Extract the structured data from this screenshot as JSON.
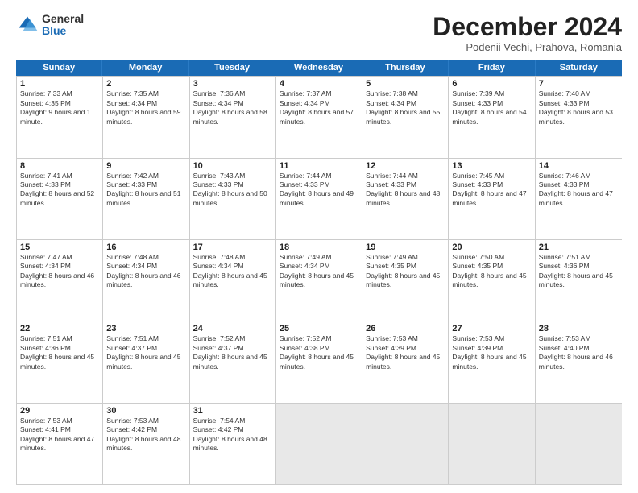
{
  "logo": {
    "general": "General",
    "blue": "Blue"
  },
  "header": {
    "month": "December 2024",
    "location": "Podenii Vechi, Prahova, Romania"
  },
  "days": [
    "Sunday",
    "Monday",
    "Tuesday",
    "Wednesday",
    "Thursday",
    "Friday",
    "Saturday"
  ],
  "weeks": [
    [
      {
        "day": "1",
        "rise": "7:33 AM",
        "set": "4:35 PM",
        "daylight": "9 hours and 1 minute."
      },
      {
        "day": "2",
        "rise": "7:35 AM",
        "set": "4:34 PM",
        "daylight": "8 hours and 59 minutes."
      },
      {
        "day": "3",
        "rise": "7:36 AM",
        "set": "4:34 PM",
        "daylight": "8 hours and 58 minutes."
      },
      {
        "day": "4",
        "rise": "7:37 AM",
        "set": "4:34 PM",
        "daylight": "8 hours and 57 minutes."
      },
      {
        "day": "5",
        "rise": "7:38 AM",
        "set": "4:34 PM",
        "daylight": "8 hours and 55 minutes."
      },
      {
        "day": "6",
        "rise": "7:39 AM",
        "set": "4:33 PM",
        "daylight": "8 hours and 54 minutes."
      },
      {
        "day": "7",
        "rise": "7:40 AM",
        "set": "4:33 PM",
        "daylight": "8 hours and 53 minutes."
      }
    ],
    [
      {
        "day": "8",
        "rise": "7:41 AM",
        "set": "4:33 PM",
        "daylight": "8 hours and 52 minutes."
      },
      {
        "day": "9",
        "rise": "7:42 AM",
        "set": "4:33 PM",
        "daylight": "8 hours and 51 minutes."
      },
      {
        "day": "10",
        "rise": "7:43 AM",
        "set": "4:33 PM",
        "daylight": "8 hours and 50 minutes."
      },
      {
        "day": "11",
        "rise": "7:44 AM",
        "set": "4:33 PM",
        "daylight": "8 hours and 49 minutes."
      },
      {
        "day": "12",
        "rise": "7:44 AM",
        "set": "4:33 PM",
        "daylight": "8 hours and 48 minutes."
      },
      {
        "day": "13",
        "rise": "7:45 AM",
        "set": "4:33 PM",
        "daylight": "8 hours and 47 minutes."
      },
      {
        "day": "14",
        "rise": "7:46 AM",
        "set": "4:33 PM",
        "daylight": "8 hours and 47 minutes."
      }
    ],
    [
      {
        "day": "15",
        "rise": "7:47 AM",
        "set": "4:34 PM",
        "daylight": "8 hours and 46 minutes."
      },
      {
        "day": "16",
        "rise": "7:48 AM",
        "set": "4:34 PM",
        "daylight": "8 hours and 46 minutes."
      },
      {
        "day": "17",
        "rise": "7:48 AM",
        "set": "4:34 PM",
        "daylight": "8 hours and 45 minutes."
      },
      {
        "day": "18",
        "rise": "7:49 AM",
        "set": "4:34 PM",
        "daylight": "8 hours and 45 minutes."
      },
      {
        "day": "19",
        "rise": "7:49 AM",
        "set": "4:35 PM",
        "daylight": "8 hours and 45 minutes."
      },
      {
        "day": "20",
        "rise": "7:50 AM",
        "set": "4:35 PM",
        "daylight": "8 hours and 45 minutes."
      },
      {
        "day": "21",
        "rise": "7:51 AM",
        "set": "4:36 PM",
        "daylight": "8 hours and 45 minutes."
      }
    ],
    [
      {
        "day": "22",
        "rise": "7:51 AM",
        "set": "4:36 PM",
        "daylight": "8 hours and 45 minutes."
      },
      {
        "day": "23",
        "rise": "7:51 AM",
        "set": "4:37 PM",
        "daylight": "8 hours and 45 minutes."
      },
      {
        "day": "24",
        "rise": "7:52 AM",
        "set": "4:37 PM",
        "daylight": "8 hours and 45 minutes."
      },
      {
        "day": "25",
        "rise": "7:52 AM",
        "set": "4:38 PM",
        "daylight": "8 hours and 45 minutes."
      },
      {
        "day": "26",
        "rise": "7:53 AM",
        "set": "4:39 PM",
        "daylight": "8 hours and 45 minutes."
      },
      {
        "day": "27",
        "rise": "7:53 AM",
        "set": "4:39 PM",
        "daylight": "8 hours and 45 minutes."
      },
      {
        "day": "28",
        "rise": "7:53 AM",
        "set": "4:40 PM",
        "daylight": "8 hours and 46 minutes."
      }
    ],
    [
      {
        "day": "29",
        "rise": "7:53 AM",
        "set": "4:41 PM",
        "daylight": "8 hours and 47 minutes."
      },
      {
        "day": "30",
        "rise": "7:53 AM",
        "set": "4:42 PM",
        "daylight": "8 hours and 48 minutes."
      },
      {
        "day": "31",
        "rise": "7:54 AM",
        "set": "4:42 PM",
        "daylight": "8 hours and 48 minutes."
      },
      null,
      null,
      null,
      null
    ]
  ],
  "labels": {
    "sunrise": "Sunrise:",
    "sunset": "Sunset:",
    "daylight": "Daylight:"
  }
}
